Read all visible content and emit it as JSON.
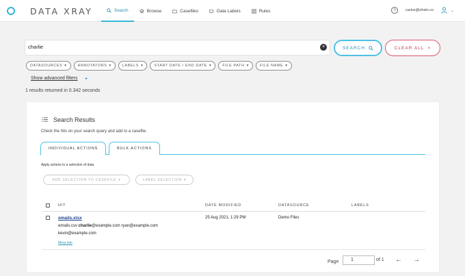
{
  "header": {
    "brand": "DATA XRAY",
    "nav": [
      {
        "label": "Search",
        "icon": "search-icon",
        "active": true
      },
      {
        "label": "Browse",
        "icon": "layers-icon",
        "active": false
      },
      {
        "label": "Casefiles",
        "icon": "folder-icon",
        "active": false
      },
      {
        "label": "Data Labels",
        "icon": "label-icon",
        "active": false
      },
      {
        "label": "Rules",
        "icon": "grid-icon",
        "active": false
      }
    ],
    "help": "?",
    "user_email": "carlos@ohalo.co"
  },
  "search": {
    "query": "charlie",
    "search_button": "SEARCH",
    "clear_button": "CLEAR ALL"
  },
  "filters": [
    "DATASOURCES",
    "ANNOTATORS",
    "LABELS",
    "START DATE / END DATE",
    "FILE PATH",
    "FILE NAME"
  ],
  "advanced_filters_link": "Show advanced filters",
  "results_summary": "1 results returned in 0.342 seconds",
  "results": {
    "title": "Search Results",
    "subtitle": "Check the hits on your search query and add to a casefile.",
    "tabs": [
      "INDIVIDUAL ACTIONS",
      "BULK ACTIONS"
    ],
    "apply_note": "Apply actions to a selection of data.",
    "actions": {
      "add_to_casefile": "ADD SELECTION TO CASEFILE",
      "label_selection": "LABEL SELECTION"
    },
    "columns": [
      "HIT",
      "DATE MODIFIED",
      "DATASOURCE",
      "LABELS"
    ],
    "rows": [
      {
        "file": "emails.xlsx",
        "snippet_pre": "emails.csv ",
        "snippet_match": "charlie",
        "snippet_post": "@example.com ryan@example.com",
        "snippet_line2": "kevin@example.com",
        "more_info": "More info",
        "date_modified": "25 Aug 2021, 1:29 PM",
        "datasource": "Demo Files",
        "labels": ""
      }
    ],
    "pagination": {
      "page_label": "Page",
      "current_page": "1",
      "of_label": "of 1"
    }
  },
  "colors": {
    "accent": "#33b6d9",
    "danger": "#e0566a",
    "link": "#1e3f8a"
  }
}
